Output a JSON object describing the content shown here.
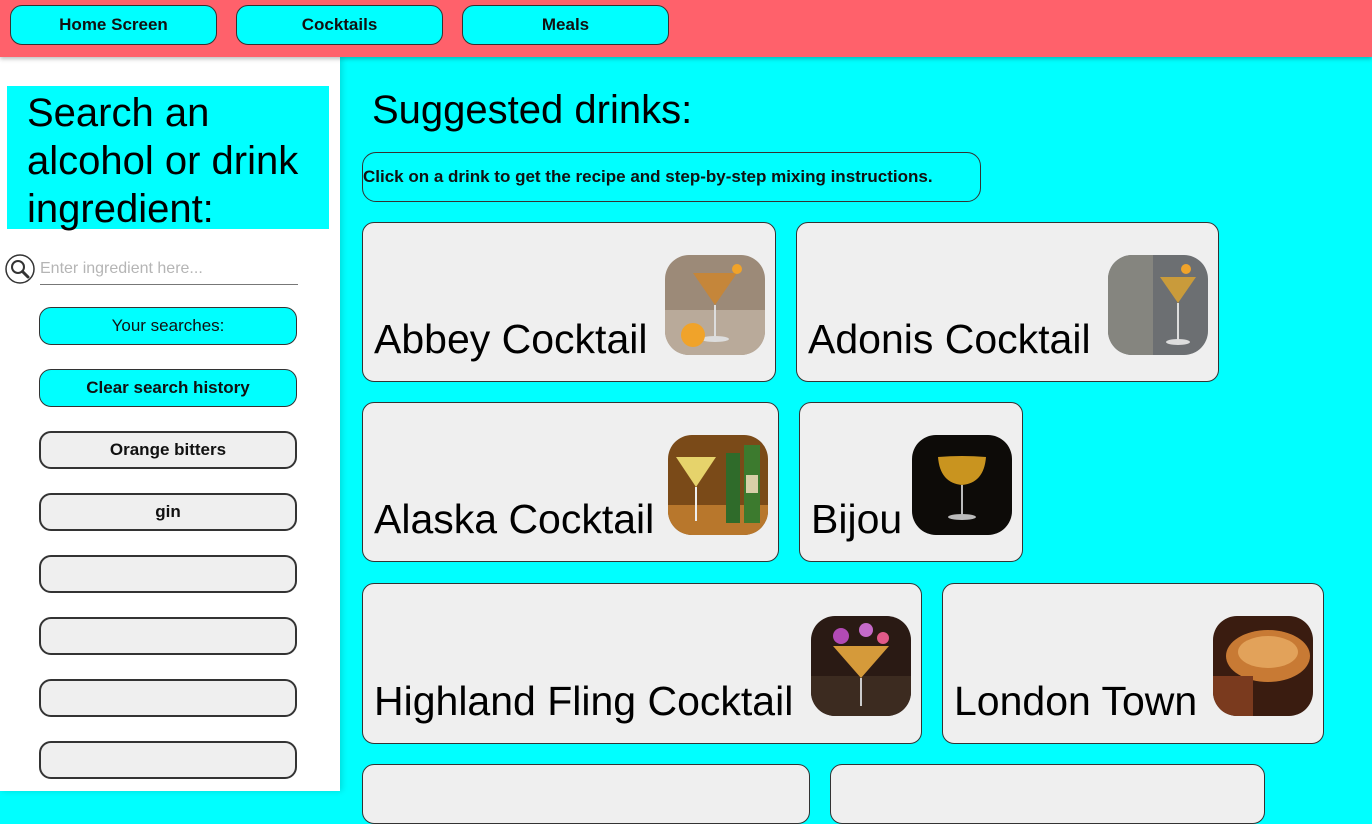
{
  "nav": {
    "home": "Home Screen",
    "cocktails": "Cocktails",
    "meals": "Meals"
  },
  "sidebar": {
    "title": "Search an alcohol or drink ingredient:",
    "search_placeholder": "Enter ingredient here...",
    "your_searches": "Your searches:",
    "clear_history": "Clear search history",
    "history": [
      "Orange bitters",
      "gin",
      "",
      "",
      "",
      ""
    ]
  },
  "main": {
    "title": "Suggested drinks:",
    "hint": "Click on a drink to get the recipe and step-by-step mixing instructions.",
    "drinks": [
      {
        "name": "Abbey Cocktail"
      },
      {
        "name": "Adonis Cocktail"
      },
      {
        "name": "Alaska Cocktail"
      },
      {
        "name": "Bijou"
      },
      {
        "name": "Highland Fling Cocktail"
      },
      {
        "name": "London Town"
      },
      {
        "name": ""
      },
      {
        "name": ""
      }
    ]
  },
  "colors": {
    "accent": "#00ffff",
    "topbar": "#ff616b",
    "card": "#efefef"
  }
}
